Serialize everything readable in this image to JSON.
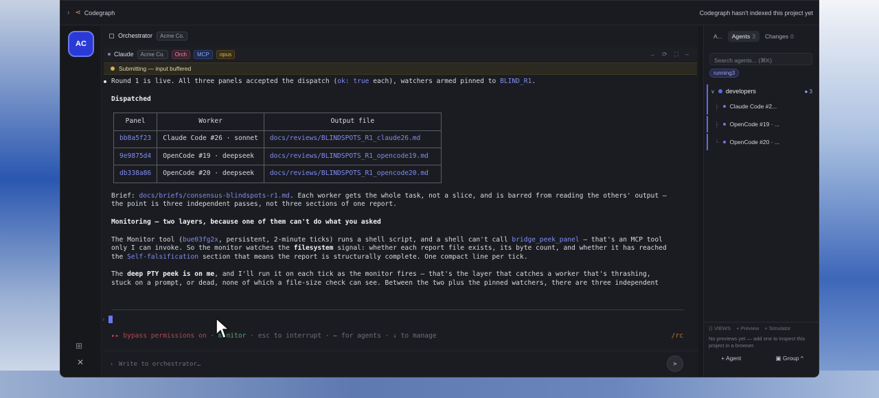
{
  "titlebar": {
    "app": "Codegraph",
    "status": "Codegraph hasn't indexed this project yet"
  },
  "rail": {
    "avatar_initials": "AC",
    "icons": [
      "grid-icon",
      "close-icon"
    ]
  },
  "orchestrator": {
    "title": "Orchestrator",
    "org": "Acme Co."
  },
  "claude_bar": {
    "name": "Claude",
    "tags": {
      "org": "Acme Co.",
      "orch": "Orch",
      "mcp": "MCP",
      "model": "opus"
    },
    "tools": [
      "→",
      "⟳",
      "⛶",
      "‒"
    ]
  },
  "status": {
    "text": "Submitting — input buffered",
    "color": "#d3b35a"
  },
  "transcript": {
    "intro_a": "Round 1 is live. All three panels accepted the dispatch (",
    "intro_code": "ok: true",
    "intro_b": " each), watchers armed pinned to ",
    "intro_ref": "BLIND_R1",
    "intro_c": ".",
    "dispatched_heading": "Dispatched",
    "table": {
      "headers": [
        "Panel",
        "Worker",
        "Output file"
      ],
      "rows": [
        [
          "bb8a5f23",
          "Claude Code #26 · sonnet",
          "docs/reviews/BLINDSPOTS_R1_claude26.md"
        ],
        [
          "9e9875d4",
          "OpenCode #19 · deepseek",
          "docs/reviews/BLINDSPOTS_R1_opencode19.md"
        ],
        [
          "db338a86",
          "OpenCode #20 · deepseek",
          "docs/reviews/BLINDSPOTS_R1_opencode20.md"
        ]
      ]
    },
    "brief_label": "Brief: ",
    "brief_link": "docs/briefs/consensus-blindspots-r1.md",
    "brief_rest1": ". Each worker gets the whole task, not a slice, and is barred from reading the others' output —",
    "brief_rest2": "the point is three independent passes, not three sections of one report.",
    "monitoring_heading": "Monitoring — two layers, because one of them can't do what you asked",
    "mon_1a": "The Monitor tool (",
    "mon_1id": "bue03fg2x",
    "mon_1b": ", persistent, 2-minute ticks) runs a shell script, and a shell can't call ",
    "mon_1tool": "bridge_peek_panel",
    "mon_1c": " — that's an MCP tool",
    "mon_2a": "only I can invoke. So the monitor watches the ",
    "mon_2b": "filesystem",
    "mon_2c": " signal: whether each report file exists, its byte count, and whether it has reached",
    "mon_3a": "the ",
    "mon_3link": "Self-falsification",
    "mon_3b": " section that means the report is structurally complete. One compact line per tick.",
    "pty_a": "The ",
    "pty_b": "deep PTY peek is on me",
    "pty_c": ", and I'll run it on each tick as the monitor fires — that's the layer that catches a worker that's thrashing,",
    "pty_2": "stuck on a prompt, or dead, none of which a file-size check can see. Between the two plus the pinned watchers, there are three independent"
  },
  "hint": {
    "bypass": "▸▸ bypass permissions on",
    "sep1": " · ",
    "monitor": "monitor",
    "rest": " · esc to interrupt · ← for agents · ↓ to manage",
    "rc": "/rc"
  },
  "composer": {
    "placeholder": "Write to orchestrator…"
  },
  "right": {
    "tabs": [
      {
        "label": "A...",
        "count": ""
      },
      {
        "label": "Agents",
        "count": "3"
      },
      {
        "label": "Changes",
        "count": "0"
      }
    ],
    "search_placeholder": "Search agents... (⌘K)",
    "running_badge": "running3",
    "group": {
      "name": "developers",
      "count": "3"
    },
    "agents": [
      "Claude Code #2...",
      "OpenCode #19 · ...",
      "OpenCode #20 · ..."
    ],
    "views": {
      "label": "VIEWS",
      "preview": "+ Preview",
      "simulator": "+ Simulator",
      "desc": "No previews yet — add one to inspect this project in a browser."
    },
    "footer": {
      "agent": "+ Agent",
      "group": "Group ^"
    }
  },
  "colors": {
    "accent": "#5d6aea",
    "link": "#7f8cf2",
    "warning": "#d3b35a"
  }
}
